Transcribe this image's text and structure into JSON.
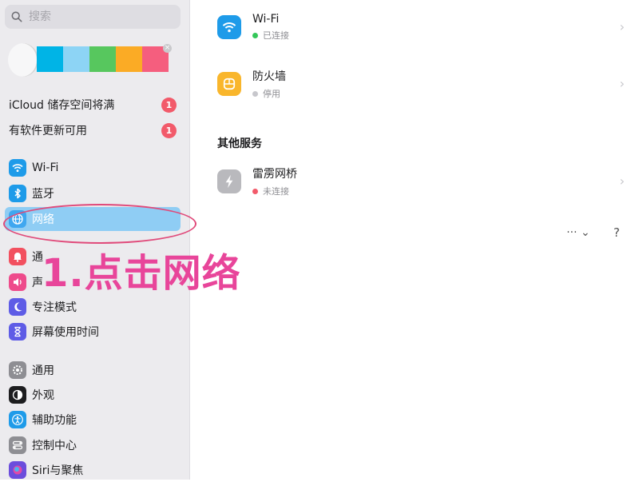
{
  "search": {
    "placeholder": "搜索"
  },
  "account": {
    "colors": [
      "#00b4e6",
      "#8dd4f5",
      "#57c75e",
      "#fbab25",
      "#f55e7e"
    ]
  },
  "notices": [
    {
      "label": "iCloud 储存空间将满",
      "badge": "1"
    },
    {
      "label": "有软件更新可用",
      "badge": "1"
    }
  ],
  "sidebar": {
    "items": [
      {
        "label": "Wi-Fi",
        "icon": "wifi-icon"
      },
      {
        "label": "蓝牙",
        "icon": "bluetooth-icon"
      },
      {
        "label": "网络",
        "icon": "globe-icon",
        "selected": true
      },
      {
        "label": "通",
        "icon": "bell-icon"
      },
      {
        "label": "声",
        "icon": "speaker-icon"
      },
      {
        "label": "专注模式",
        "icon": "moon-icon"
      },
      {
        "label": "屏幕使用时间",
        "icon": "hourglass-icon"
      },
      {
        "label": "通用",
        "icon": "gear-icon"
      },
      {
        "label": "外观",
        "icon": "appearance-icon"
      },
      {
        "label": "辅助功能",
        "icon": "accessibility-icon"
      },
      {
        "label": "控制中心",
        "icon": "control-center-icon"
      },
      {
        "label": "Siri与聚焦",
        "icon": "siri-icon"
      }
    ]
  },
  "annotation": {
    "text": "1.点击网络"
  },
  "main": {
    "services": [
      {
        "name": "Wi-Fi",
        "status": "已连接",
        "status_color": "#34c759",
        "icon": "wifi-icon",
        "icon_bg": "#1e9be9"
      },
      {
        "name": "防火墙",
        "status": "停用",
        "status_color": "#c7c7cc",
        "icon": "firewall-icon",
        "icon_bg": "#f9b62c"
      }
    ],
    "other_title": "其他服务",
    "other_services": [
      {
        "name": "雷雳网桥",
        "status": "未连接",
        "status_color": "#f25a6a",
        "icon": "thunderbolt-icon",
        "icon_bg": "#b9b9bd"
      }
    ],
    "more_label": "··· ⌄",
    "help_label": "?"
  }
}
